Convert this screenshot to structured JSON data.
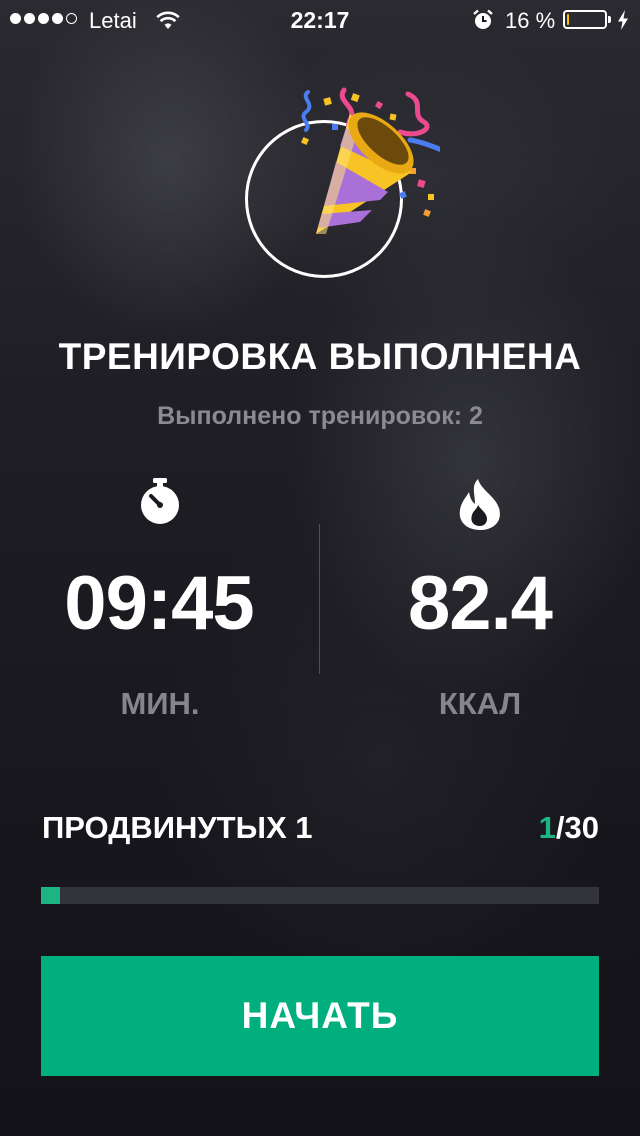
{
  "status_bar": {
    "carrier": "Letai",
    "time": "22:17",
    "battery_percent": "16 %",
    "battery_level": 0.16,
    "signal_bars_filled": 4,
    "signal_bars_total": 5
  },
  "workout": {
    "icon": "party-popper-icon",
    "title": "ТРЕНИРОВКА ВЫПОЛНЕНА",
    "completed_label": "Выполнено тренировок: 2"
  },
  "stats": {
    "duration": {
      "icon": "stopwatch-icon",
      "value": "09:45",
      "unit": "МИН."
    },
    "calories": {
      "icon": "flame-icon",
      "value": "82.4",
      "unit": "ККАЛ"
    }
  },
  "level": {
    "name": "ПРОДВИНУТЫХ 1",
    "current": "1",
    "total": "/30",
    "progress": 0.0333
  },
  "start_button": {
    "label": "НАЧАТЬ"
  },
  "colors": {
    "accent": "#00ae7e",
    "accent_text": "#1db483",
    "progress_track": "#33343b",
    "muted_text": "#8a8a90",
    "battery": "#f5c400"
  }
}
